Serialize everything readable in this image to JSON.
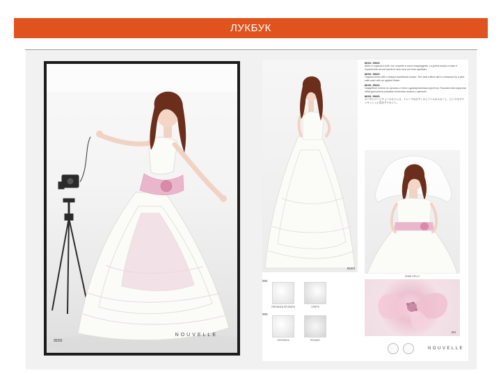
{
  "slide": {
    "title": "ЛУКБУК"
  },
  "spread": {
    "left_page": {
      "model_code": "9520I",
      "brand": "NOUVELLE"
    },
    "right_page": {
      "main_photo_code": "9520I",
      "descriptions": [
        {
          "heading": "MOD. 9520I",
          "body": "Abito in organza e tulle, con corpetto a cuore drappeggiato. La gonna ampia a balze è impreziosita da una fascia in raso rosa con fiore applicato."
        },
        {
          "heading": "MOD. 9520I",
          "body": "Organza dress with a draped sweetheart bodice. The wide ruffled skirt is enhanced by a pink satin sash with an applied flower."
        },
        {
          "heading": "MOD. 9520I",
          "body": "Свадебное платье из органзы и тюля с драпированным корсетом. Пышная многоярусная юбка дополнена розовым атласным поясом с цветком."
        },
        {
          "heading": "MOD. 9520I",
          "body": "オーガンジーとチュールのドレス。ドレープのボディスとフリルのスカート、ピンクのサテンサッシュと花のアクセント。"
        }
      ],
      "veil_caption": "9066 VELO",
      "swatches": [
        {
          "number": "002",
          "items": [
            {
              "label": "ORGANZA SFUMATA"
            },
            {
              "label": "CREPE"
            }
          ]
        },
        {
          "number": "003",
          "items": [
            {
              "label": "ORGANZA"
            },
            {
              "label": "RICAMO"
            }
          ]
        }
      ],
      "detail_code": "00I",
      "brand": "NOUVELLE"
    }
  },
  "colors": {
    "title_bar": "#e0531e",
    "title_text": "#ffffff",
    "page_background": "#f1f1f1",
    "dress_pink": "#eab6cc",
    "hair": "#6b2e1c"
  }
}
